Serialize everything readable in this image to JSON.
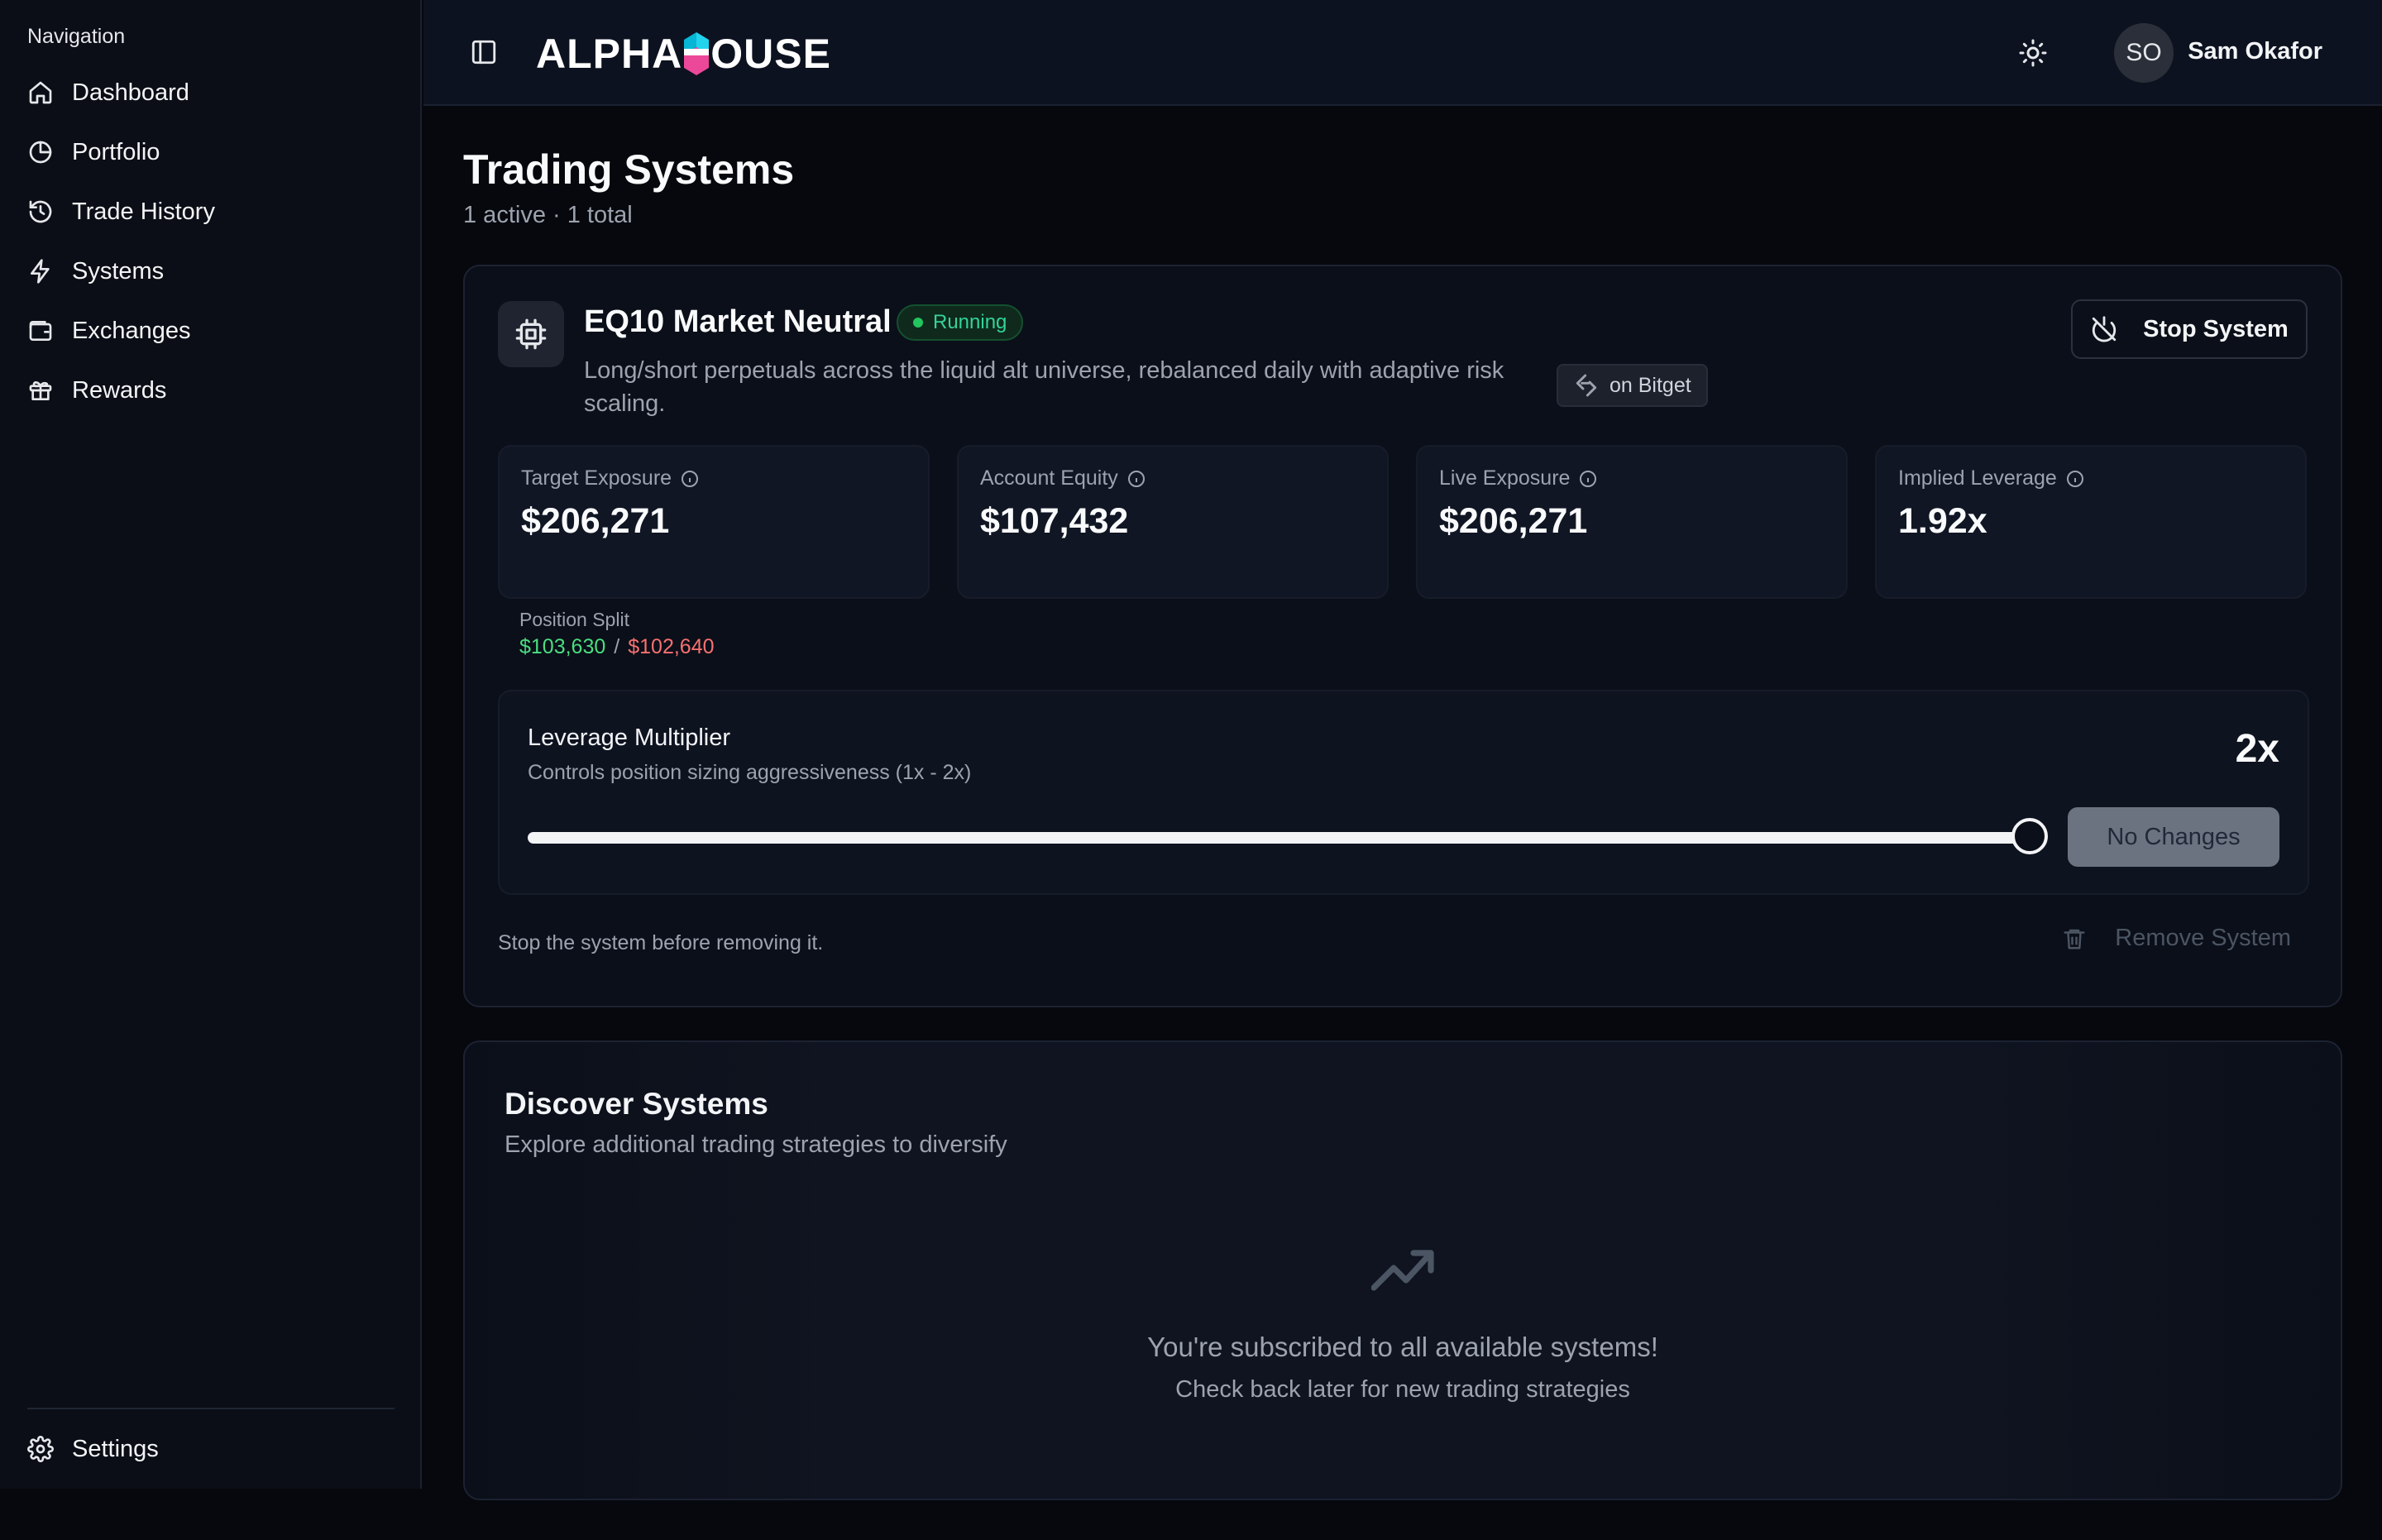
{
  "sidebar": {
    "heading": "Navigation",
    "items": [
      {
        "label": "Dashboard",
        "icon": "home-icon"
      },
      {
        "label": "Portfolio",
        "icon": "pie-chart-icon"
      },
      {
        "label": "Trade History",
        "icon": "history-icon"
      },
      {
        "label": "Systems",
        "icon": "bolt-icon"
      },
      {
        "label": "Exchanges",
        "icon": "wallet-icon"
      },
      {
        "label": "Rewards",
        "icon": "gift-icon"
      }
    ],
    "settings_label": "Settings"
  },
  "header": {
    "logo_left": "ALPHA",
    "logo_right": "OUSE",
    "user_initials": "SO",
    "user_name": "Sam Okafor"
  },
  "page": {
    "title": "Trading Systems",
    "subtitle": "1 active · 1 total"
  },
  "system": {
    "name": "EQ10 Market Neutral",
    "status": "Running",
    "description": "Long/short perpetuals across the liquid alt universe, rebalanced daily with adaptive risk scaling.",
    "exchange": "on Bitget",
    "stop_label": "Stop System",
    "metrics": [
      {
        "label": "Target Exposure",
        "value": "$206,271"
      },
      {
        "label": "Account Equity",
        "value": "$107,432"
      },
      {
        "label": "Live Exposure",
        "value": "$206,271"
      },
      {
        "label": "Implied Leverage",
        "value": "1.92x"
      }
    ],
    "position_split": {
      "label": "Position Split",
      "long": "$103,630",
      "separator": "/",
      "short": "$102,640"
    },
    "leverage": {
      "title": "Leverage Multiplier",
      "subtitle": "Controls position sizing aggressiveness (1x - 2x)",
      "value_label": "2x",
      "min": 1,
      "max": 2,
      "value": 2,
      "button_label": "No Changes"
    },
    "remove_note": "Stop the system before removing it.",
    "remove_label": "Remove System"
  },
  "discover": {
    "title": "Discover Systems",
    "subtitle": "Explore additional trading strategies to diversify",
    "empty_title": "You're subscribed to all available systems!",
    "empty_subtitle": "Check back later for new trading strategies"
  },
  "colors": {
    "accent_green": "#22c55e",
    "long_green": "#4ade80",
    "short_red": "#f87171",
    "logo_cyan": "#22d3ee",
    "logo_pink": "#ec4899"
  }
}
